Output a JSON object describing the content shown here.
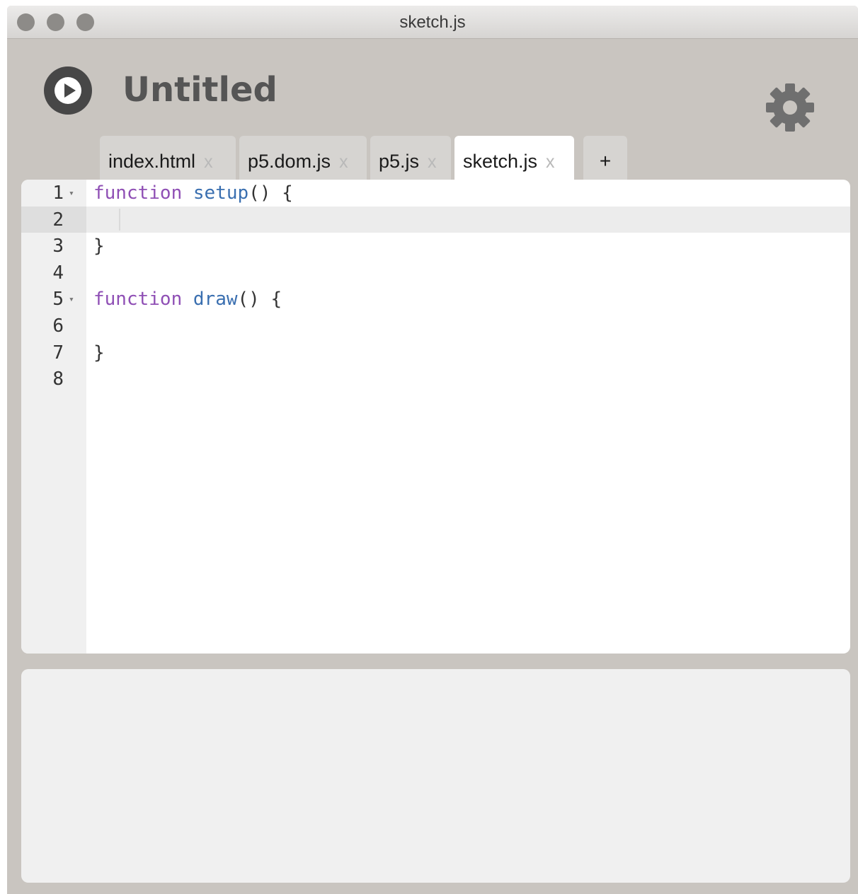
{
  "window": {
    "title": "sketch.js"
  },
  "header": {
    "project_title": "Untitled",
    "run_icon": "play-icon",
    "settings_icon": "gear-icon"
  },
  "tabs": [
    {
      "label": "index.html",
      "close": "x",
      "active": false
    },
    {
      "label": "p5.dom.js",
      "close": "x",
      "active": false
    },
    {
      "label": "p5.js",
      "close": "x",
      "active": false
    },
    {
      "label": "sketch.js",
      "close": "x",
      "active": true
    }
  ],
  "add_tab_label": "+",
  "editor": {
    "current_line": 2,
    "lines": [
      {
        "num": "1",
        "fold": "▾",
        "tokens": [
          [
            "kw",
            "function"
          ],
          [
            "plain",
            " "
          ],
          [
            "fn",
            "setup"
          ],
          [
            "plain",
            "() {"
          ]
        ]
      },
      {
        "num": "2",
        "fold": "",
        "tokens": []
      },
      {
        "num": "3",
        "fold": "",
        "tokens": [
          [
            "plain",
            "}"
          ]
        ]
      },
      {
        "num": "4",
        "fold": "",
        "tokens": []
      },
      {
        "num": "5",
        "fold": "▾",
        "tokens": [
          [
            "kw",
            "function"
          ],
          [
            "plain",
            " "
          ],
          [
            "fn",
            "draw"
          ],
          [
            "plain",
            "() {"
          ]
        ]
      },
      {
        "num": "6",
        "fold": "",
        "tokens": []
      },
      {
        "num": "7",
        "fold": "",
        "tokens": [
          [
            "plain",
            "}"
          ]
        ]
      },
      {
        "num": "8",
        "fold": "",
        "tokens": []
      }
    ]
  },
  "colors": {
    "keyword": "#8f4fb5",
    "function_name": "#3a6fb0",
    "window_chrome": "#c9c5c0"
  }
}
